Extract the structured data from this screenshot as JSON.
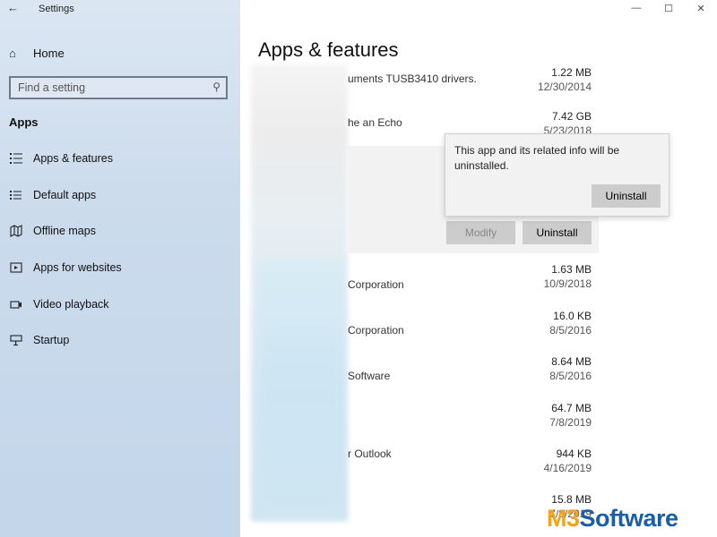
{
  "window": {
    "title": "Settings",
    "controls": {
      "minimize": "—",
      "maximize": "☐",
      "close": "✕"
    },
    "back_glyph": "←"
  },
  "sidebar": {
    "home": {
      "label": "Home",
      "icon": "home-icon",
      "glyph": "⌂"
    },
    "search": {
      "placeholder": "Find a setting",
      "icon": "search-icon",
      "glyph": "⚲"
    },
    "section": "Apps",
    "items": [
      {
        "label": "Apps & features",
        "icon": "apps-features-icon"
      },
      {
        "label": "Default apps",
        "icon": "default-apps-icon"
      },
      {
        "label": "Offline maps",
        "icon": "map-icon"
      },
      {
        "label": "Apps for websites",
        "icon": "website-icon"
      },
      {
        "label": "Video playback",
        "icon": "video-icon"
      },
      {
        "label": "Startup",
        "icon": "startup-icon"
      }
    ]
  },
  "main": {
    "title": "Apps & features",
    "apps": [
      {
        "publisher": "uments TUSB3410 drivers.",
        "size": "1.22 MB",
        "date": "12/30/2014"
      },
      {
        "publisher": "he an Echo",
        "size": "7.42 GB",
        "date": "5/23/2018"
      },
      {
        "publisher": "Corporation",
        "size": "1.63 MB",
        "date": "10/9/2018"
      },
      {
        "publisher": "Corporation",
        "size": "16.0 KB",
        "date": "8/5/2016"
      },
      {
        "publisher": "Software",
        "size": "8.64 MB",
        "date": "8/5/2016"
      },
      {
        "publisher": "",
        "size": "64.7 MB",
        "date": "7/8/2019"
      },
      {
        "publisher": "r Outlook",
        "size": "944 KB",
        "date": "4/16/2019"
      },
      {
        "publisher": "",
        "size": "15.8 MB",
        "date": "7/8/2019"
      }
    ],
    "buttons": {
      "modify": "Modify",
      "uninstall": "Uninstall"
    },
    "flyout": {
      "message": "This app and its related info will be uninstalled.",
      "confirm": "Uninstall"
    }
  },
  "watermark": {
    "part1": "M3",
    "part2": "Software",
    "colors": [
      "#f2a21b",
      "#1a5da8"
    ]
  }
}
